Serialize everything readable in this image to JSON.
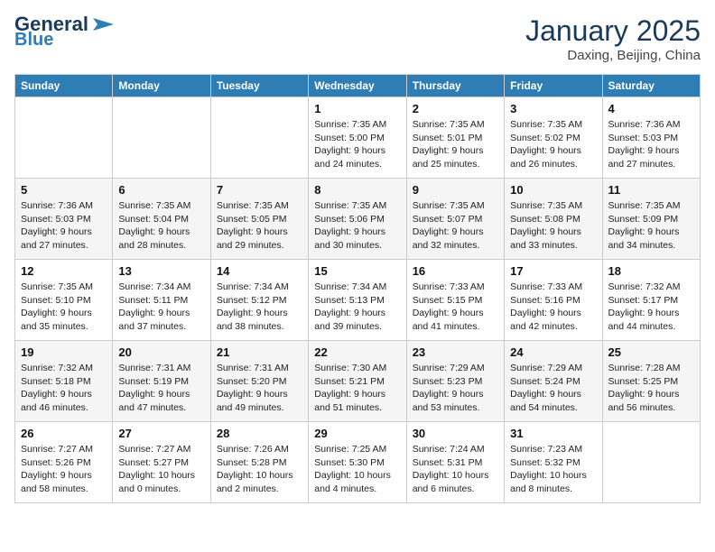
{
  "logo": {
    "part1": "General",
    "part2": "Blue"
  },
  "title": "January 2025",
  "location": "Daxing, Beijing, China",
  "days_of_week": [
    "Sunday",
    "Monday",
    "Tuesday",
    "Wednesday",
    "Thursday",
    "Friday",
    "Saturday"
  ],
  "weeks": [
    [
      {
        "day": "",
        "info": ""
      },
      {
        "day": "",
        "info": ""
      },
      {
        "day": "",
        "info": ""
      },
      {
        "day": "1",
        "info": "Sunrise: 7:35 AM\nSunset: 5:00 PM\nDaylight: 9 hours\nand 24 minutes."
      },
      {
        "day": "2",
        "info": "Sunrise: 7:35 AM\nSunset: 5:01 PM\nDaylight: 9 hours\nand 25 minutes."
      },
      {
        "day": "3",
        "info": "Sunrise: 7:35 AM\nSunset: 5:02 PM\nDaylight: 9 hours\nand 26 minutes."
      },
      {
        "day": "4",
        "info": "Sunrise: 7:36 AM\nSunset: 5:03 PM\nDaylight: 9 hours\nand 27 minutes."
      }
    ],
    [
      {
        "day": "5",
        "info": "Sunrise: 7:36 AM\nSunset: 5:03 PM\nDaylight: 9 hours\nand 27 minutes."
      },
      {
        "day": "6",
        "info": "Sunrise: 7:35 AM\nSunset: 5:04 PM\nDaylight: 9 hours\nand 28 minutes."
      },
      {
        "day": "7",
        "info": "Sunrise: 7:35 AM\nSunset: 5:05 PM\nDaylight: 9 hours\nand 29 minutes."
      },
      {
        "day": "8",
        "info": "Sunrise: 7:35 AM\nSunset: 5:06 PM\nDaylight: 9 hours\nand 30 minutes."
      },
      {
        "day": "9",
        "info": "Sunrise: 7:35 AM\nSunset: 5:07 PM\nDaylight: 9 hours\nand 32 minutes."
      },
      {
        "day": "10",
        "info": "Sunrise: 7:35 AM\nSunset: 5:08 PM\nDaylight: 9 hours\nand 33 minutes."
      },
      {
        "day": "11",
        "info": "Sunrise: 7:35 AM\nSunset: 5:09 PM\nDaylight: 9 hours\nand 34 minutes."
      }
    ],
    [
      {
        "day": "12",
        "info": "Sunrise: 7:35 AM\nSunset: 5:10 PM\nDaylight: 9 hours\nand 35 minutes."
      },
      {
        "day": "13",
        "info": "Sunrise: 7:34 AM\nSunset: 5:11 PM\nDaylight: 9 hours\nand 37 minutes."
      },
      {
        "day": "14",
        "info": "Sunrise: 7:34 AM\nSunset: 5:12 PM\nDaylight: 9 hours\nand 38 minutes."
      },
      {
        "day": "15",
        "info": "Sunrise: 7:34 AM\nSunset: 5:13 PM\nDaylight: 9 hours\nand 39 minutes."
      },
      {
        "day": "16",
        "info": "Sunrise: 7:33 AM\nSunset: 5:15 PM\nDaylight: 9 hours\nand 41 minutes."
      },
      {
        "day": "17",
        "info": "Sunrise: 7:33 AM\nSunset: 5:16 PM\nDaylight: 9 hours\nand 42 minutes."
      },
      {
        "day": "18",
        "info": "Sunrise: 7:32 AM\nSunset: 5:17 PM\nDaylight: 9 hours\nand 44 minutes."
      }
    ],
    [
      {
        "day": "19",
        "info": "Sunrise: 7:32 AM\nSunset: 5:18 PM\nDaylight: 9 hours\nand 46 minutes."
      },
      {
        "day": "20",
        "info": "Sunrise: 7:31 AM\nSunset: 5:19 PM\nDaylight: 9 hours\nand 47 minutes."
      },
      {
        "day": "21",
        "info": "Sunrise: 7:31 AM\nSunset: 5:20 PM\nDaylight: 9 hours\nand 49 minutes."
      },
      {
        "day": "22",
        "info": "Sunrise: 7:30 AM\nSunset: 5:21 PM\nDaylight: 9 hours\nand 51 minutes."
      },
      {
        "day": "23",
        "info": "Sunrise: 7:29 AM\nSunset: 5:23 PM\nDaylight: 9 hours\nand 53 minutes."
      },
      {
        "day": "24",
        "info": "Sunrise: 7:29 AM\nSunset: 5:24 PM\nDaylight: 9 hours\nand 54 minutes."
      },
      {
        "day": "25",
        "info": "Sunrise: 7:28 AM\nSunset: 5:25 PM\nDaylight: 9 hours\nand 56 minutes."
      }
    ],
    [
      {
        "day": "26",
        "info": "Sunrise: 7:27 AM\nSunset: 5:26 PM\nDaylight: 9 hours\nand 58 minutes."
      },
      {
        "day": "27",
        "info": "Sunrise: 7:27 AM\nSunset: 5:27 PM\nDaylight: 10 hours\nand 0 minutes."
      },
      {
        "day": "28",
        "info": "Sunrise: 7:26 AM\nSunset: 5:28 PM\nDaylight: 10 hours\nand 2 minutes."
      },
      {
        "day": "29",
        "info": "Sunrise: 7:25 AM\nSunset: 5:30 PM\nDaylight: 10 hours\nand 4 minutes."
      },
      {
        "day": "30",
        "info": "Sunrise: 7:24 AM\nSunset: 5:31 PM\nDaylight: 10 hours\nand 6 minutes."
      },
      {
        "day": "31",
        "info": "Sunrise: 7:23 AM\nSunset: 5:32 PM\nDaylight: 10 hours\nand 8 minutes."
      },
      {
        "day": "",
        "info": ""
      }
    ]
  ]
}
